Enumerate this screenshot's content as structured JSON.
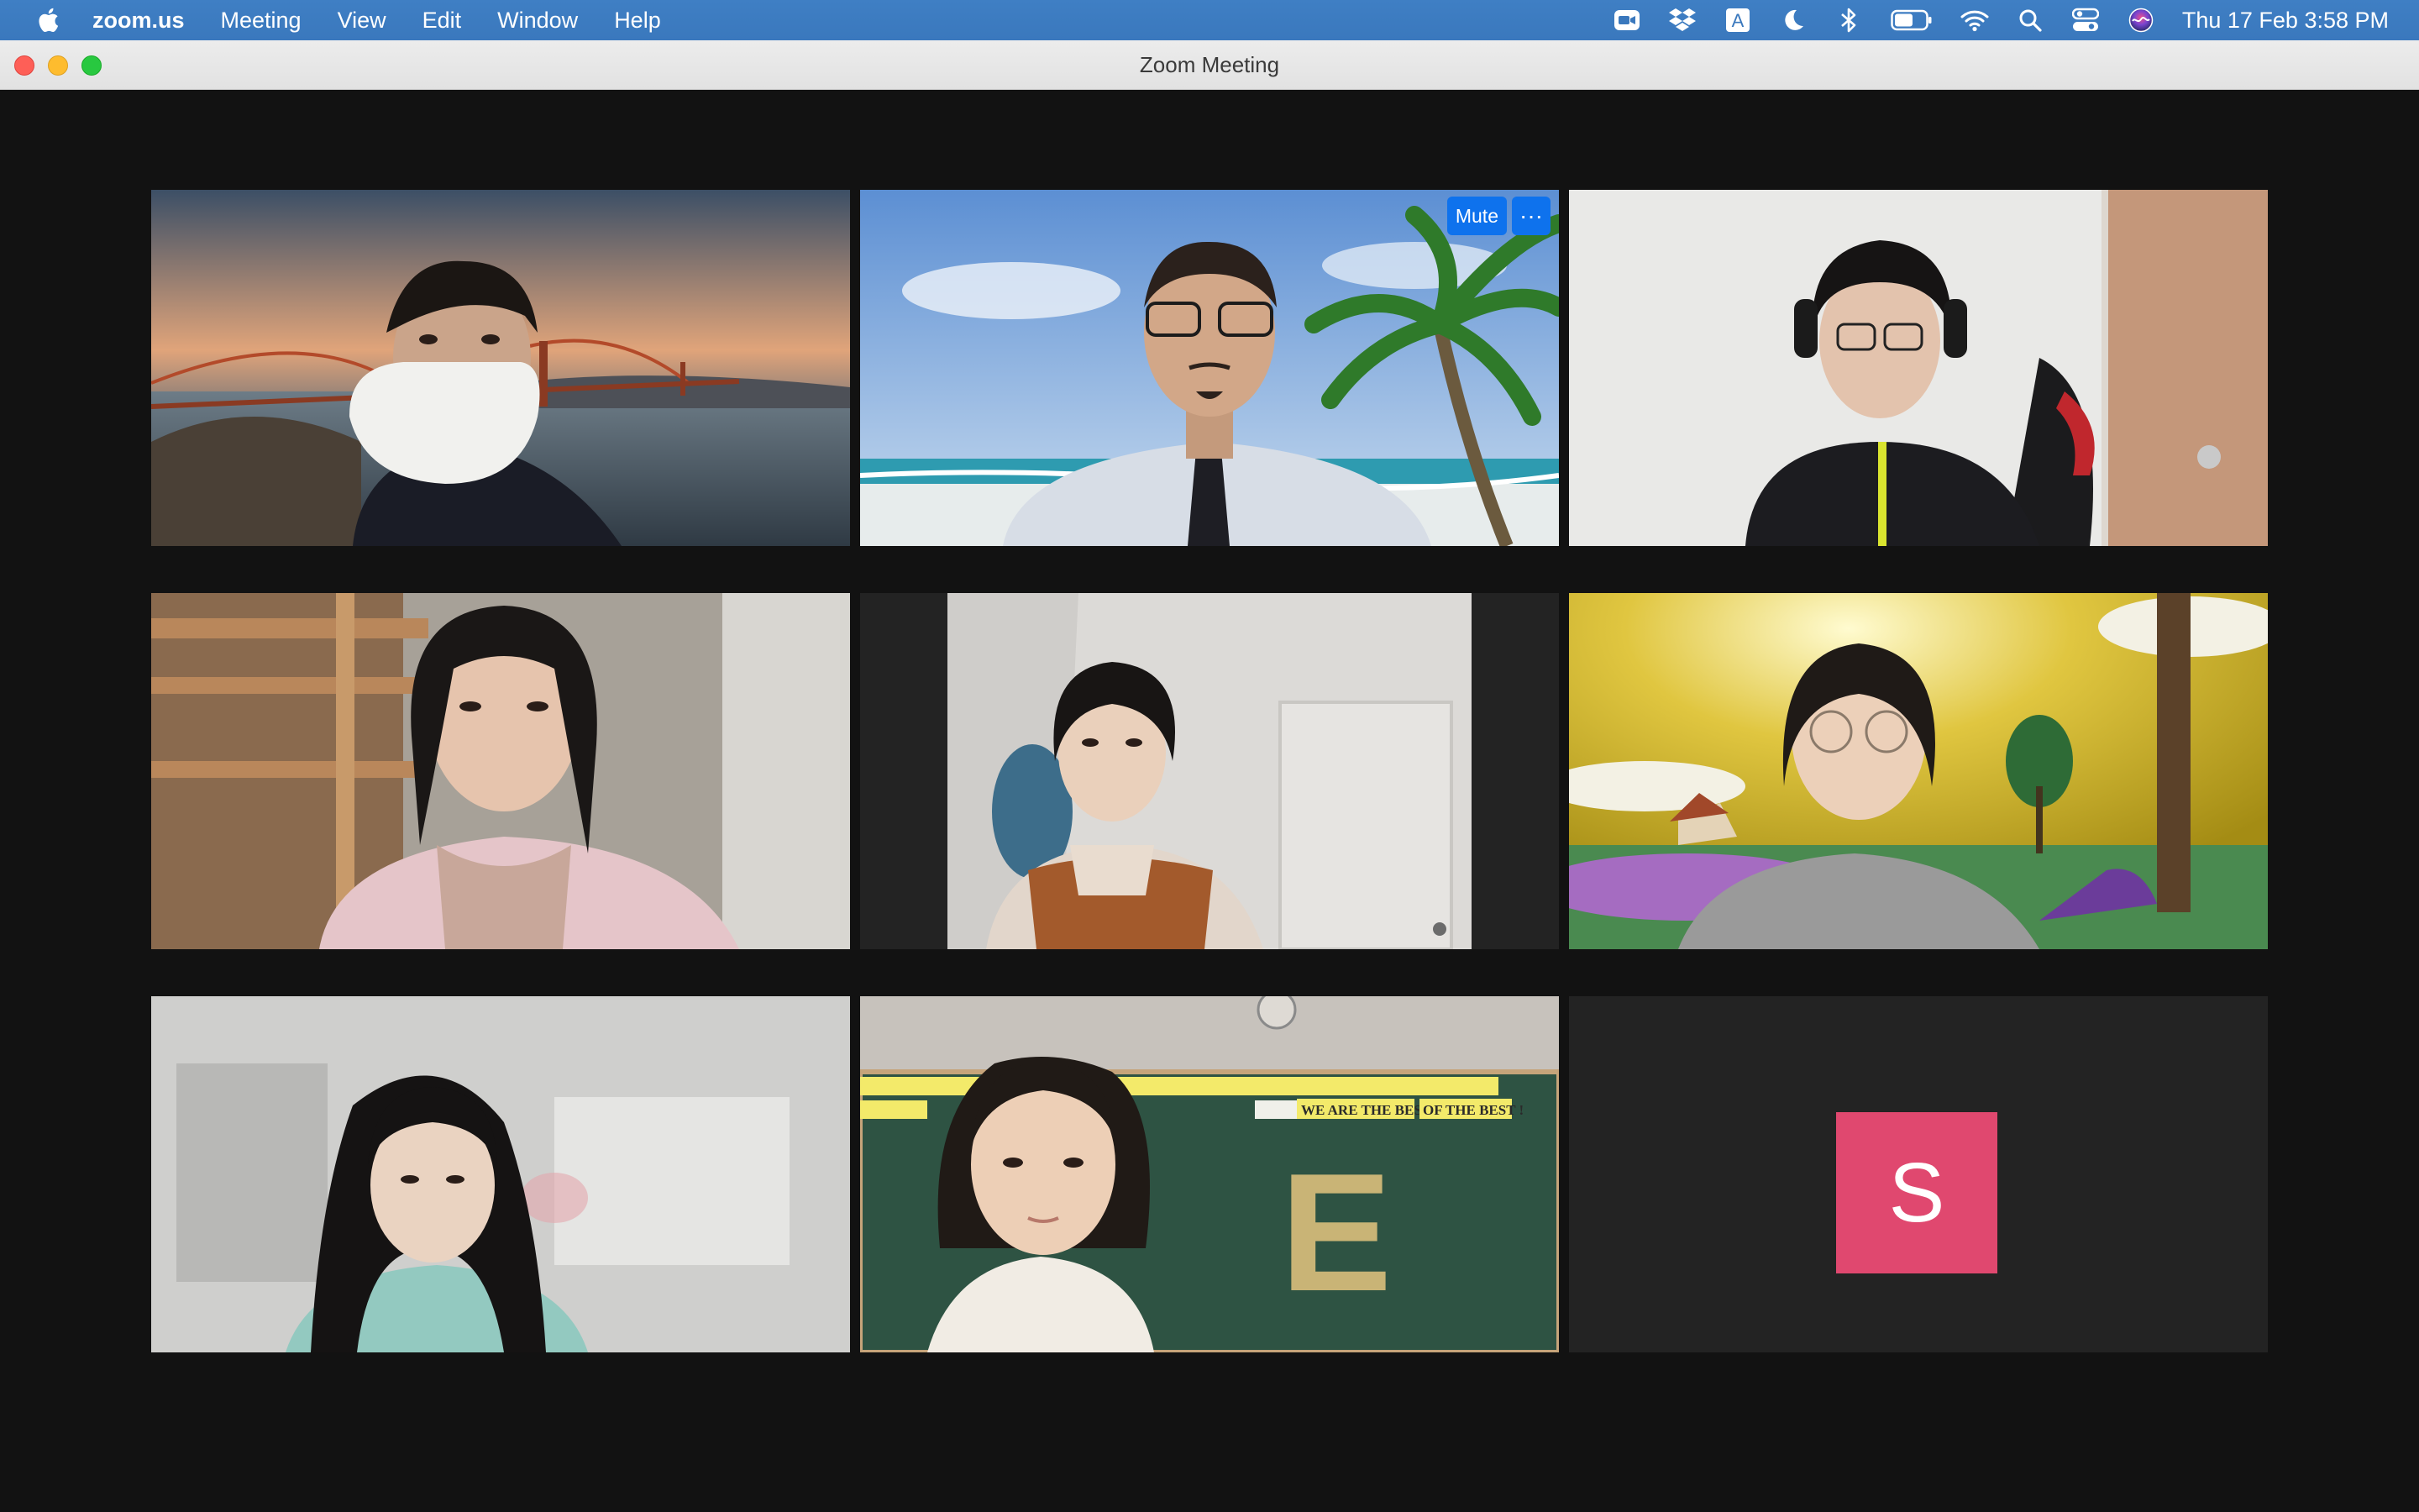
{
  "menubar": {
    "app_name": "zoom.us",
    "menus": [
      "Meeting",
      "View",
      "Edit",
      "Window",
      "Help"
    ],
    "clock": "Thu 17 Feb  3:58 PM",
    "icons": [
      "zoom-icon",
      "dropbox-icon",
      "input-source-icon",
      "focus-moon-icon",
      "bluetooth-icon",
      "battery-icon",
      "wifi-icon",
      "spotlight-search-icon",
      "control-center-icon",
      "siri-icon"
    ],
    "input_source_letter": "A"
  },
  "window": {
    "title": "Zoom Meeting"
  },
  "gallery": {
    "active_speaker_border": "#3fd243",
    "controls": {
      "mute_label": "Mute",
      "more_label": "···"
    },
    "tiles": [
      {
        "id": "participant-1",
        "background": "golden-gate-bridge-sunset"
      },
      {
        "id": "participant-2",
        "background": "tropical-beach-palm",
        "active": true
      },
      {
        "id": "participant-3",
        "background": "room-with-door"
      },
      {
        "id": "participant-4",
        "background": "bunk-bed-room"
      },
      {
        "id": "participant-5",
        "background": "white-room"
      },
      {
        "id": "participant-6",
        "background": "yellow-sky-cartoon"
      },
      {
        "id": "participant-7",
        "background": "blurred-room"
      },
      {
        "id": "participant-8",
        "background": "classroom-chalkboard",
        "board_text": [
          "WE ARE THE BEST",
          "OF THE BEST !"
        ],
        "chalk_letter": "E"
      },
      {
        "id": "participant-9",
        "video_off": true,
        "avatar_initial": "S",
        "avatar_color": "#e0486f"
      }
    ]
  }
}
